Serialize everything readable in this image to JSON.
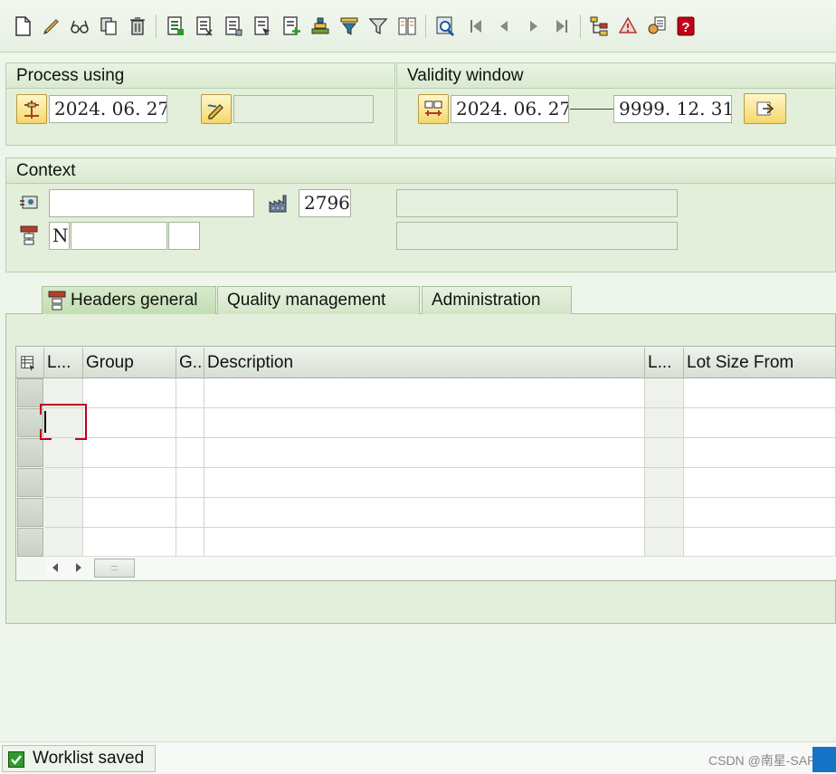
{
  "toolbar": {
    "icons": [
      "new-document-icon",
      "edit-pencil-icon",
      "display-glasses-icon",
      "copy-icon",
      "delete-trash-icon",
      "select-all-icon",
      "deselect-icon",
      "details-icon",
      "choose-icon",
      "insert-line-icon",
      "sort-icon",
      "filter-icon",
      "set-filter-icon",
      "columns-icon",
      "find-icon",
      "first-page-icon",
      "previous-page-icon",
      "next-page-icon",
      "last-page-icon",
      "hierarchy-icon",
      "warning-icon",
      "where-used-icon",
      "help-icon"
    ]
  },
  "process_using": {
    "title": "Process using",
    "key_date": "2024. 06. 27",
    "change_number": ""
  },
  "validity_window": {
    "title": "Validity window",
    "from": "2024. 06. 27",
    "to": "9999. 12. 31"
  },
  "context": {
    "title": "Context",
    "material": "",
    "plant": "2796",
    "material_desc": "",
    "task_list_type": "N",
    "group": "",
    "group_counter": "",
    "group_desc": ""
  },
  "tabs": [
    {
      "label": "Headers general",
      "active": true
    },
    {
      "label": "Quality management",
      "active": false
    },
    {
      "label": "Administration",
      "active": false
    }
  ],
  "table": {
    "columns": [
      "L...",
      "Group",
      "G..",
      "Description",
      "L...",
      "Lot Size From"
    ],
    "rows": [
      [
        "",
        "",
        "",
        "",
        "",
        ""
      ],
      [
        "",
        "",
        "",
        "",
        "",
        ""
      ],
      [
        "",
        "",
        "",
        "",
        "",
        ""
      ],
      [
        "",
        "",
        "",
        "",
        "",
        ""
      ],
      [
        "",
        "",
        "",
        "",
        "",
        ""
      ],
      [
        "",
        "",
        "",
        "",
        "",
        ""
      ]
    ]
  },
  "status": {
    "message": "Worklist saved",
    "watermark": "CSDN @南星-SAP"
  },
  "colors": {
    "background": "#eef5ea",
    "panel": "#e3efdb",
    "accent_yellow": "#f4d86a",
    "status_green": "#2e9b2e",
    "error_red": "#c0001a"
  }
}
